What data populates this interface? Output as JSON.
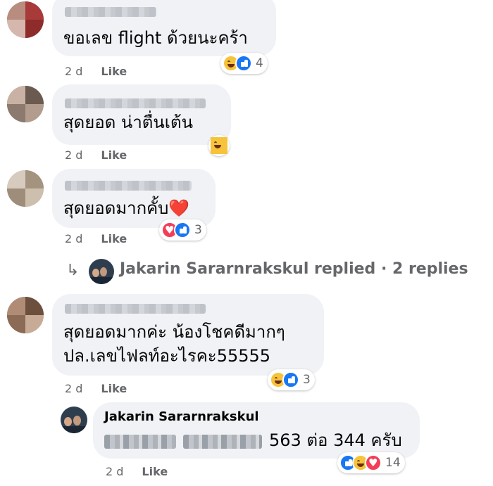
{
  "comments": [
    {
      "text": "ขอเลข flight ด้วยนะคร้า",
      "time": "2 d",
      "like_label": "Like",
      "reactions": [
        "haha-icon",
        "like-icon"
      ],
      "reaction_count": "4"
    },
    {
      "text": "สุดยอด น่าตื่นเต้น",
      "time": "2 d",
      "like_label": "Like",
      "reactions": [
        "haha-icon"
      ]
    },
    {
      "text": "สุดยอดมากคั้บ",
      "text_emoji": "❤️",
      "time": "2 d",
      "like_label": "Like",
      "reactions": [
        "love-icon",
        "like-icon"
      ],
      "reaction_count": "3"
    },
    {
      "text_line1": "สุดยอดมากค่ะ น้องโชคดีมากๆ",
      "text_line2": "ปล.เลขไฟลท์อะไรคะ55555",
      "time": "2 d",
      "like_label": "Like",
      "reactions": [
        "haha-icon",
        "like-icon"
      ],
      "reaction_count": "3"
    }
  ],
  "replies_summary": {
    "text": "Jakarin Sararnrakskul replied · 2 replies",
    "arrow_icon": "reply-arrow-icon"
  },
  "reply": {
    "author": "Jakarin Sararnrakskul",
    "text": "563 ต่อ 344 ครับ",
    "time": "2 d",
    "like_label": "Like",
    "reactions": [
      "like-icon",
      "haha-icon",
      "love-icon"
    ],
    "reaction_count": "14"
  },
  "colors": {
    "bubble": "#f0f2f5",
    "meta": "#65676b",
    "like": "#1877f2",
    "love": "#f33e58",
    "haha": "#f7c33b"
  }
}
